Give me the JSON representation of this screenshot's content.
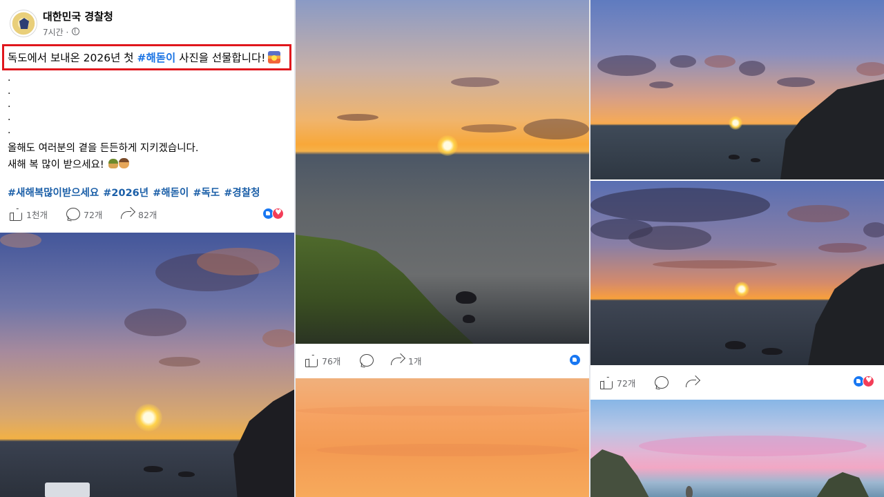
{
  "post": {
    "page_name": "대한민국 경찰청",
    "time": "7시간 ·",
    "headline_before": "독도에서 보내온 2026년 첫 ",
    "headline_tag": "#해돋이",
    "headline_after": " 사진을 선물합니다!",
    "dots": ".\n.\n.\n.\n.",
    "line_1": "올해도 여러분의 곁을 든든하게 지키겠습니다.",
    "line_2": "새해 복 많이 받으세요!",
    "hashtags": "#새해복많이받으세요 #2026년 #해돋이 #독도 #경찰청",
    "likes": "1천개",
    "comments": "72개",
    "shares": "82개"
  },
  "photo_mid": {
    "likes": "76개",
    "shares": "1개"
  },
  "photo_right": {
    "likes": "72개"
  },
  "colors": {
    "hashtag": "#1b5fa8",
    "highlight_border": "#e0161c",
    "like_blue": "#1877f2",
    "love_red": "#f33e58"
  },
  "icons": [
    "globe-icon",
    "like-icon",
    "comment-icon",
    "share-icon",
    "like-reaction-icon",
    "love-reaction-icon",
    "sunrise-emoji",
    "emoji-pair"
  ]
}
